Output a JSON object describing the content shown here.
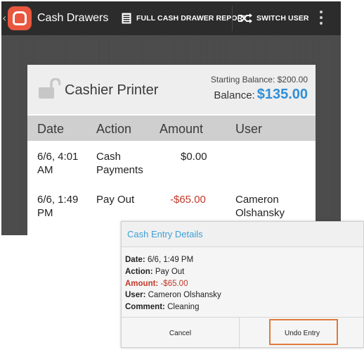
{
  "actionbar": {
    "title": "Cash Drawers",
    "back_glyph": "‹",
    "full_report_label": "FULL CASH DRAWER REPORT",
    "switch_user_label": "SWITCH USER",
    "icons": [
      "back-chevron-icon",
      "app-logo-icon",
      "report-icon",
      "shuffle-icon",
      "overflow-menu-icon"
    ]
  },
  "drawer": {
    "name": "Cashier Printer",
    "starting_balance_label": "Starting Balance: $200.00",
    "balance_label": "Balance:",
    "balance_value": "$135.00"
  },
  "table": {
    "headers": [
      "Date",
      "Action",
      "Amount",
      "User"
    ],
    "rows": [
      {
        "date_line1": "6/6, 4:01",
        "date_line2": "AM",
        "action_line1": "Cash",
        "action_line2": "Payments",
        "amount": "$0.00",
        "user_line1": "",
        "user_line2": ""
      },
      {
        "date_line1": "6/6, 1:49",
        "date_line2": "PM",
        "action_line1": "Pay Out",
        "action_line2": "",
        "amount": "-$65.00",
        "user_line1": "Cameron",
        "user_line2": "Olshansky"
      }
    ]
  },
  "dialog": {
    "title": "Cash Entry Details",
    "date_label": "Date:",
    "date_value": "6/6, 1:49 PM",
    "action_label": "Action:",
    "action_value": "Pay Out",
    "amount_label": "Amount:",
    "amount_value": "-$65.00",
    "user_label": "User:",
    "user_value": "Cameron Olshansky",
    "comment_label": "Comment:",
    "comment_value": "Cleaning",
    "cancel_label": "Cancel",
    "undo_label": "Undo Entry"
  },
  "colors": {
    "accent": "#2f8fd8",
    "negative": "#c0392b",
    "logo": "#e9573f",
    "highlight": "#e07a3a"
  }
}
